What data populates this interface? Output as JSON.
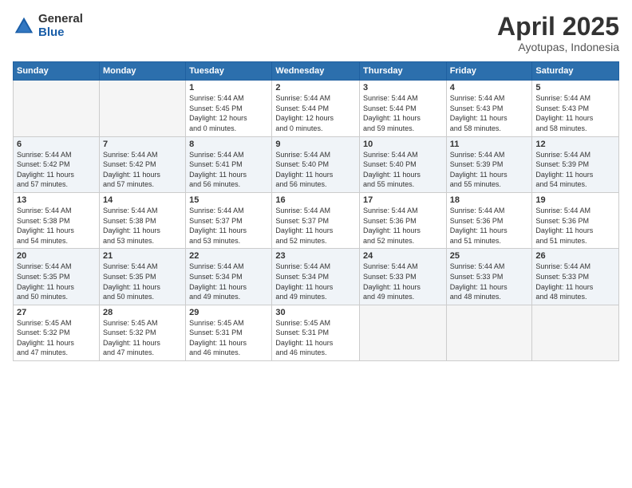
{
  "logo": {
    "general": "General",
    "blue": "Blue"
  },
  "title": "April 2025",
  "subtitle": "Ayotupas, Indonesia",
  "headers": [
    "Sunday",
    "Monday",
    "Tuesday",
    "Wednesday",
    "Thursday",
    "Friday",
    "Saturday"
  ],
  "weeks": [
    [
      {
        "day": "",
        "info": ""
      },
      {
        "day": "",
        "info": ""
      },
      {
        "day": "1",
        "info": "Sunrise: 5:44 AM\nSunset: 5:45 PM\nDaylight: 12 hours\nand 0 minutes."
      },
      {
        "day": "2",
        "info": "Sunrise: 5:44 AM\nSunset: 5:44 PM\nDaylight: 12 hours\nand 0 minutes."
      },
      {
        "day": "3",
        "info": "Sunrise: 5:44 AM\nSunset: 5:44 PM\nDaylight: 11 hours\nand 59 minutes."
      },
      {
        "day": "4",
        "info": "Sunrise: 5:44 AM\nSunset: 5:43 PM\nDaylight: 11 hours\nand 58 minutes."
      },
      {
        "day": "5",
        "info": "Sunrise: 5:44 AM\nSunset: 5:43 PM\nDaylight: 11 hours\nand 58 minutes."
      }
    ],
    [
      {
        "day": "6",
        "info": "Sunrise: 5:44 AM\nSunset: 5:42 PM\nDaylight: 11 hours\nand 57 minutes."
      },
      {
        "day": "7",
        "info": "Sunrise: 5:44 AM\nSunset: 5:42 PM\nDaylight: 11 hours\nand 57 minutes."
      },
      {
        "day": "8",
        "info": "Sunrise: 5:44 AM\nSunset: 5:41 PM\nDaylight: 11 hours\nand 56 minutes."
      },
      {
        "day": "9",
        "info": "Sunrise: 5:44 AM\nSunset: 5:40 PM\nDaylight: 11 hours\nand 56 minutes."
      },
      {
        "day": "10",
        "info": "Sunrise: 5:44 AM\nSunset: 5:40 PM\nDaylight: 11 hours\nand 55 minutes."
      },
      {
        "day": "11",
        "info": "Sunrise: 5:44 AM\nSunset: 5:39 PM\nDaylight: 11 hours\nand 55 minutes."
      },
      {
        "day": "12",
        "info": "Sunrise: 5:44 AM\nSunset: 5:39 PM\nDaylight: 11 hours\nand 54 minutes."
      }
    ],
    [
      {
        "day": "13",
        "info": "Sunrise: 5:44 AM\nSunset: 5:38 PM\nDaylight: 11 hours\nand 54 minutes."
      },
      {
        "day": "14",
        "info": "Sunrise: 5:44 AM\nSunset: 5:38 PM\nDaylight: 11 hours\nand 53 minutes."
      },
      {
        "day": "15",
        "info": "Sunrise: 5:44 AM\nSunset: 5:37 PM\nDaylight: 11 hours\nand 53 minutes."
      },
      {
        "day": "16",
        "info": "Sunrise: 5:44 AM\nSunset: 5:37 PM\nDaylight: 11 hours\nand 52 minutes."
      },
      {
        "day": "17",
        "info": "Sunrise: 5:44 AM\nSunset: 5:36 PM\nDaylight: 11 hours\nand 52 minutes."
      },
      {
        "day": "18",
        "info": "Sunrise: 5:44 AM\nSunset: 5:36 PM\nDaylight: 11 hours\nand 51 minutes."
      },
      {
        "day": "19",
        "info": "Sunrise: 5:44 AM\nSunset: 5:36 PM\nDaylight: 11 hours\nand 51 minutes."
      }
    ],
    [
      {
        "day": "20",
        "info": "Sunrise: 5:44 AM\nSunset: 5:35 PM\nDaylight: 11 hours\nand 50 minutes."
      },
      {
        "day": "21",
        "info": "Sunrise: 5:44 AM\nSunset: 5:35 PM\nDaylight: 11 hours\nand 50 minutes."
      },
      {
        "day": "22",
        "info": "Sunrise: 5:44 AM\nSunset: 5:34 PM\nDaylight: 11 hours\nand 49 minutes."
      },
      {
        "day": "23",
        "info": "Sunrise: 5:44 AM\nSunset: 5:34 PM\nDaylight: 11 hours\nand 49 minutes."
      },
      {
        "day": "24",
        "info": "Sunrise: 5:44 AM\nSunset: 5:33 PM\nDaylight: 11 hours\nand 49 minutes."
      },
      {
        "day": "25",
        "info": "Sunrise: 5:44 AM\nSunset: 5:33 PM\nDaylight: 11 hours\nand 48 minutes."
      },
      {
        "day": "26",
        "info": "Sunrise: 5:44 AM\nSunset: 5:33 PM\nDaylight: 11 hours\nand 48 minutes."
      }
    ],
    [
      {
        "day": "27",
        "info": "Sunrise: 5:45 AM\nSunset: 5:32 PM\nDaylight: 11 hours\nand 47 minutes."
      },
      {
        "day": "28",
        "info": "Sunrise: 5:45 AM\nSunset: 5:32 PM\nDaylight: 11 hours\nand 47 minutes."
      },
      {
        "day": "29",
        "info": "Sunrise: 5:45 AM\nSunset: 5:31 PM\nDaylight: 11 hours\nand 46 minutes."
      },
      {
        "day": "30",
        "info": "Sunrise: 5:45 AM\nSunset: 5:31 PM\nDaylight: 11 hours\nand 46 minutes."
      },
      {
        "day": "",
        "info": ""
      },
      {
        "day": "",
        "info": ""
      },
      {
        "day": "",
        "info": ""
      }
    ]
  ]
}
